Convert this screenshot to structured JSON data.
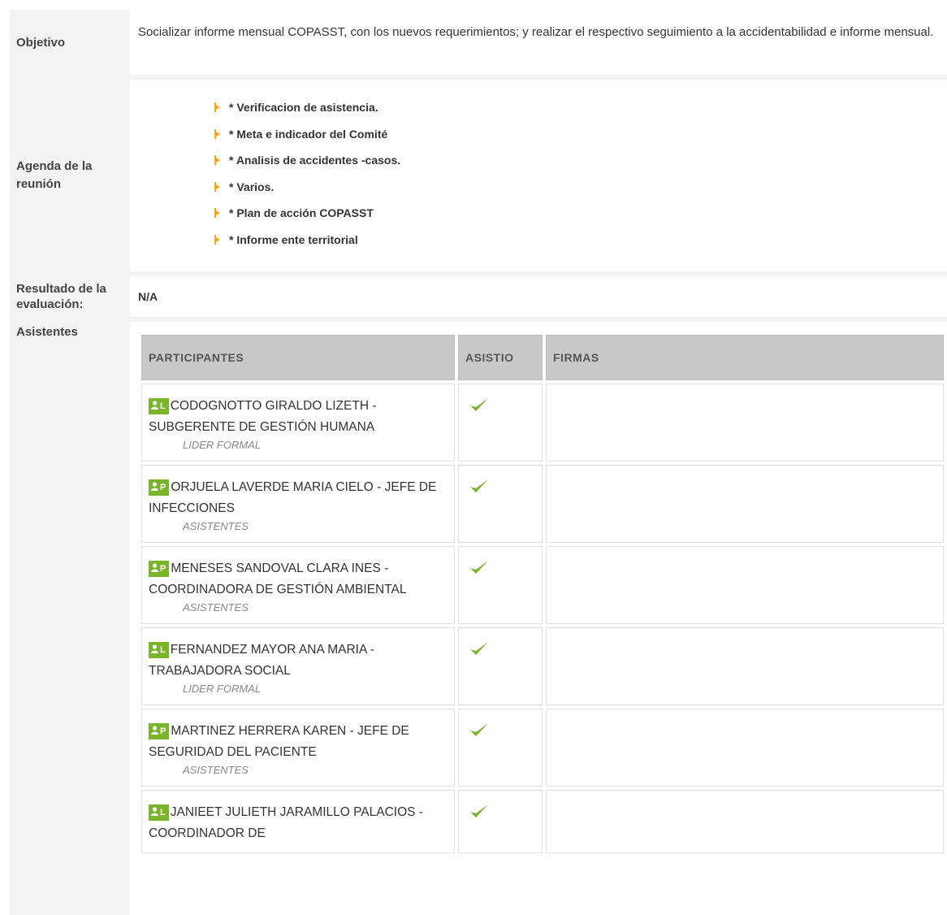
{
  "objetivo": {
    "label": "Objetivo",
    "text": "Socializar informe mensual COPASST, con los nuevos requerimientos; y realizar el respectivo seguimiento a la accidentabilidad e informe mensual."
  },
  "agenda": {
    "label": "Agenda de la reunión",
    "items": [
      "* Verificacion de asistencia.",
      "* Meta e indicador del Comité",
      "* Analisis de accidentes -casos.",
      "* Varios.",
      "* Plan de acción COPASST",
      "* Informe ente territorial"
    ]
  },
  "resultado": {
    "label": "Resultado de la evaluación:",
    "value": "N/A"
  },
  "asistentes": {
    "label": "Asistentes",
    "columns": [
      "PARTICIPANTES",
      "ASISTIO",
      "FIRMAS"
    ],
    "rows": [
      {
        "badge": "L",
        "name": "CODOGNOTTO GIRALDO LIZETH - SUBGERENTE DE GESTIÓN HUMANA",
        "role": "LIDER FORMAL",
        "asistio": true
      },
      {
        "badge": "P",
        "name": "ORJUELA LAVERDE MARIA CIELO - JEFE DE INFECCIONES",
        "role": "ASISTENTES",
        "asistio": true
      },
      {
        "badge": "P",
        "name": "MENESES SANDOVAL CLARA INES - COORDINADORA DE GESTIÓN AMBIENTAL",
        "role": "ASISTENTES",
        "asistio": true
      },
      {
        "badge": "L",
        "name": "FERNANDEZ MAYOR ANA MARIA - TRABAJADORA SOCIAL",
        "role": "LIDER FORMAL",
        "asistio": true
      },
      {
        "badge": "P",
        "name": "MARTINEZ HERRERA KAREN - JEFE DE SEGURIDAD DEL PACIENTE",
        "role": "ASISTENTES",
        "asistio": true
      },
      {
        "badge": "L",
        "name": "JANIEET JULIETH JARAMILLO PALACIOS - COORDINADOR DE",
        "role": "",
        "asistio": true
      }
    ]
  },
  "colors": {
    "accent_green": "#7ab42a",
    "bullet_orange": "#f5a623",
    "header_gray": "#c8c8c8"
  },
  "icons": {
    "badge": "user-icon",
    "check": "check-icon",
    "bullet": "arrow-bullet-icon"
  }
}
